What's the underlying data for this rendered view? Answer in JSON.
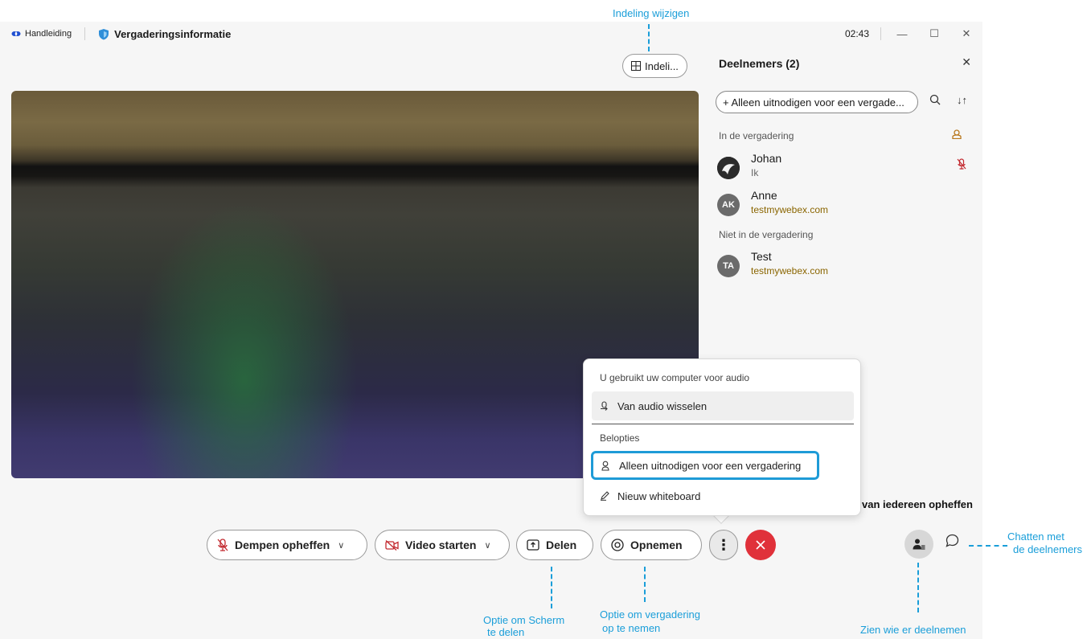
{
  "titlebar": {
    "manual_label": "Handleiding",
    "meeting_info_label": "Vergaderingsinformatie",
    "time": "02:43",
    "minimize": "—",
    "maximize": "☐",
    "close": "✕"
  },
  "layout_button": {
    "label": "Indeli..."
  },
  "participants": {
    "title": "Deelnemers (2)",
    "close": "✕",
    "invite_label": "+ Alleen uitnodigen voor een vergade...",
    "in_meeting_label": "In de vergadering",
    "not_in_meeting_label": "Niet in de vergadering",
    "people": [
      {
        "name": "Johan",
        "sub": "Ik",
        "initials": ""
      },
      {
        "name": "Anne",
        "sub": "testmywebex.com",
        "initials": "AK"
      },
      {
        "name": "Test",
        "sub": "testmywebex.com",
        "initials": "TA"
      }
    ]
  },
  "menu": {
    "audio_header": "U gebruikt uw computer voor audio",
    "switch_audio": "Van audio wisselen",
    "call_header": "Belopties",
    "invite_only": "Alleen uitnodigen voor een vergadering",
    "new_whiteboard": "Nieuw whiteboard"
  },
  "background_text": "van iedereen opheffen",
  "toolbar": {
    "unmute": "Dempen opheffen",
    "start_video": "Video starten",
    "share": "Delen",
    "record": "Opnemen"
  },
  "annotations": {
    "layout": "Indeling wijzigen",
    "share_line1": "Optie om Scherm",
    "share_line2": "te delen",
    "record_line1": "Optie om vergadering",
    "record_line2": "op te nemen",
    "participants": "Zien wie er deelnemen",
    "chat_line1": "Chatten met",
    "chat_line2": "de deelnemers"
  },
  "colors": {
    "accent_blue": "#1a9ed9",
    "end_red": "#e0313a",
    "muted_red": "#c2272d"
  },
  "icons": [
    "webex-icon",
    "shield-icon",
    "grid-icon",
    "search-icon",
    "sort-icon",
    "host-icon",
    "mic-muted-icon",
    "phone-switch-icon",
    "person-add-icon",
    "pen-icon",
    "chevron-down-icon",
    "video-off-icon",
    "share-icon",
    "record-icon",
    "more-icon",
    "close-icon",
    "people-icon",
    "chat-icon"
  ]
}
